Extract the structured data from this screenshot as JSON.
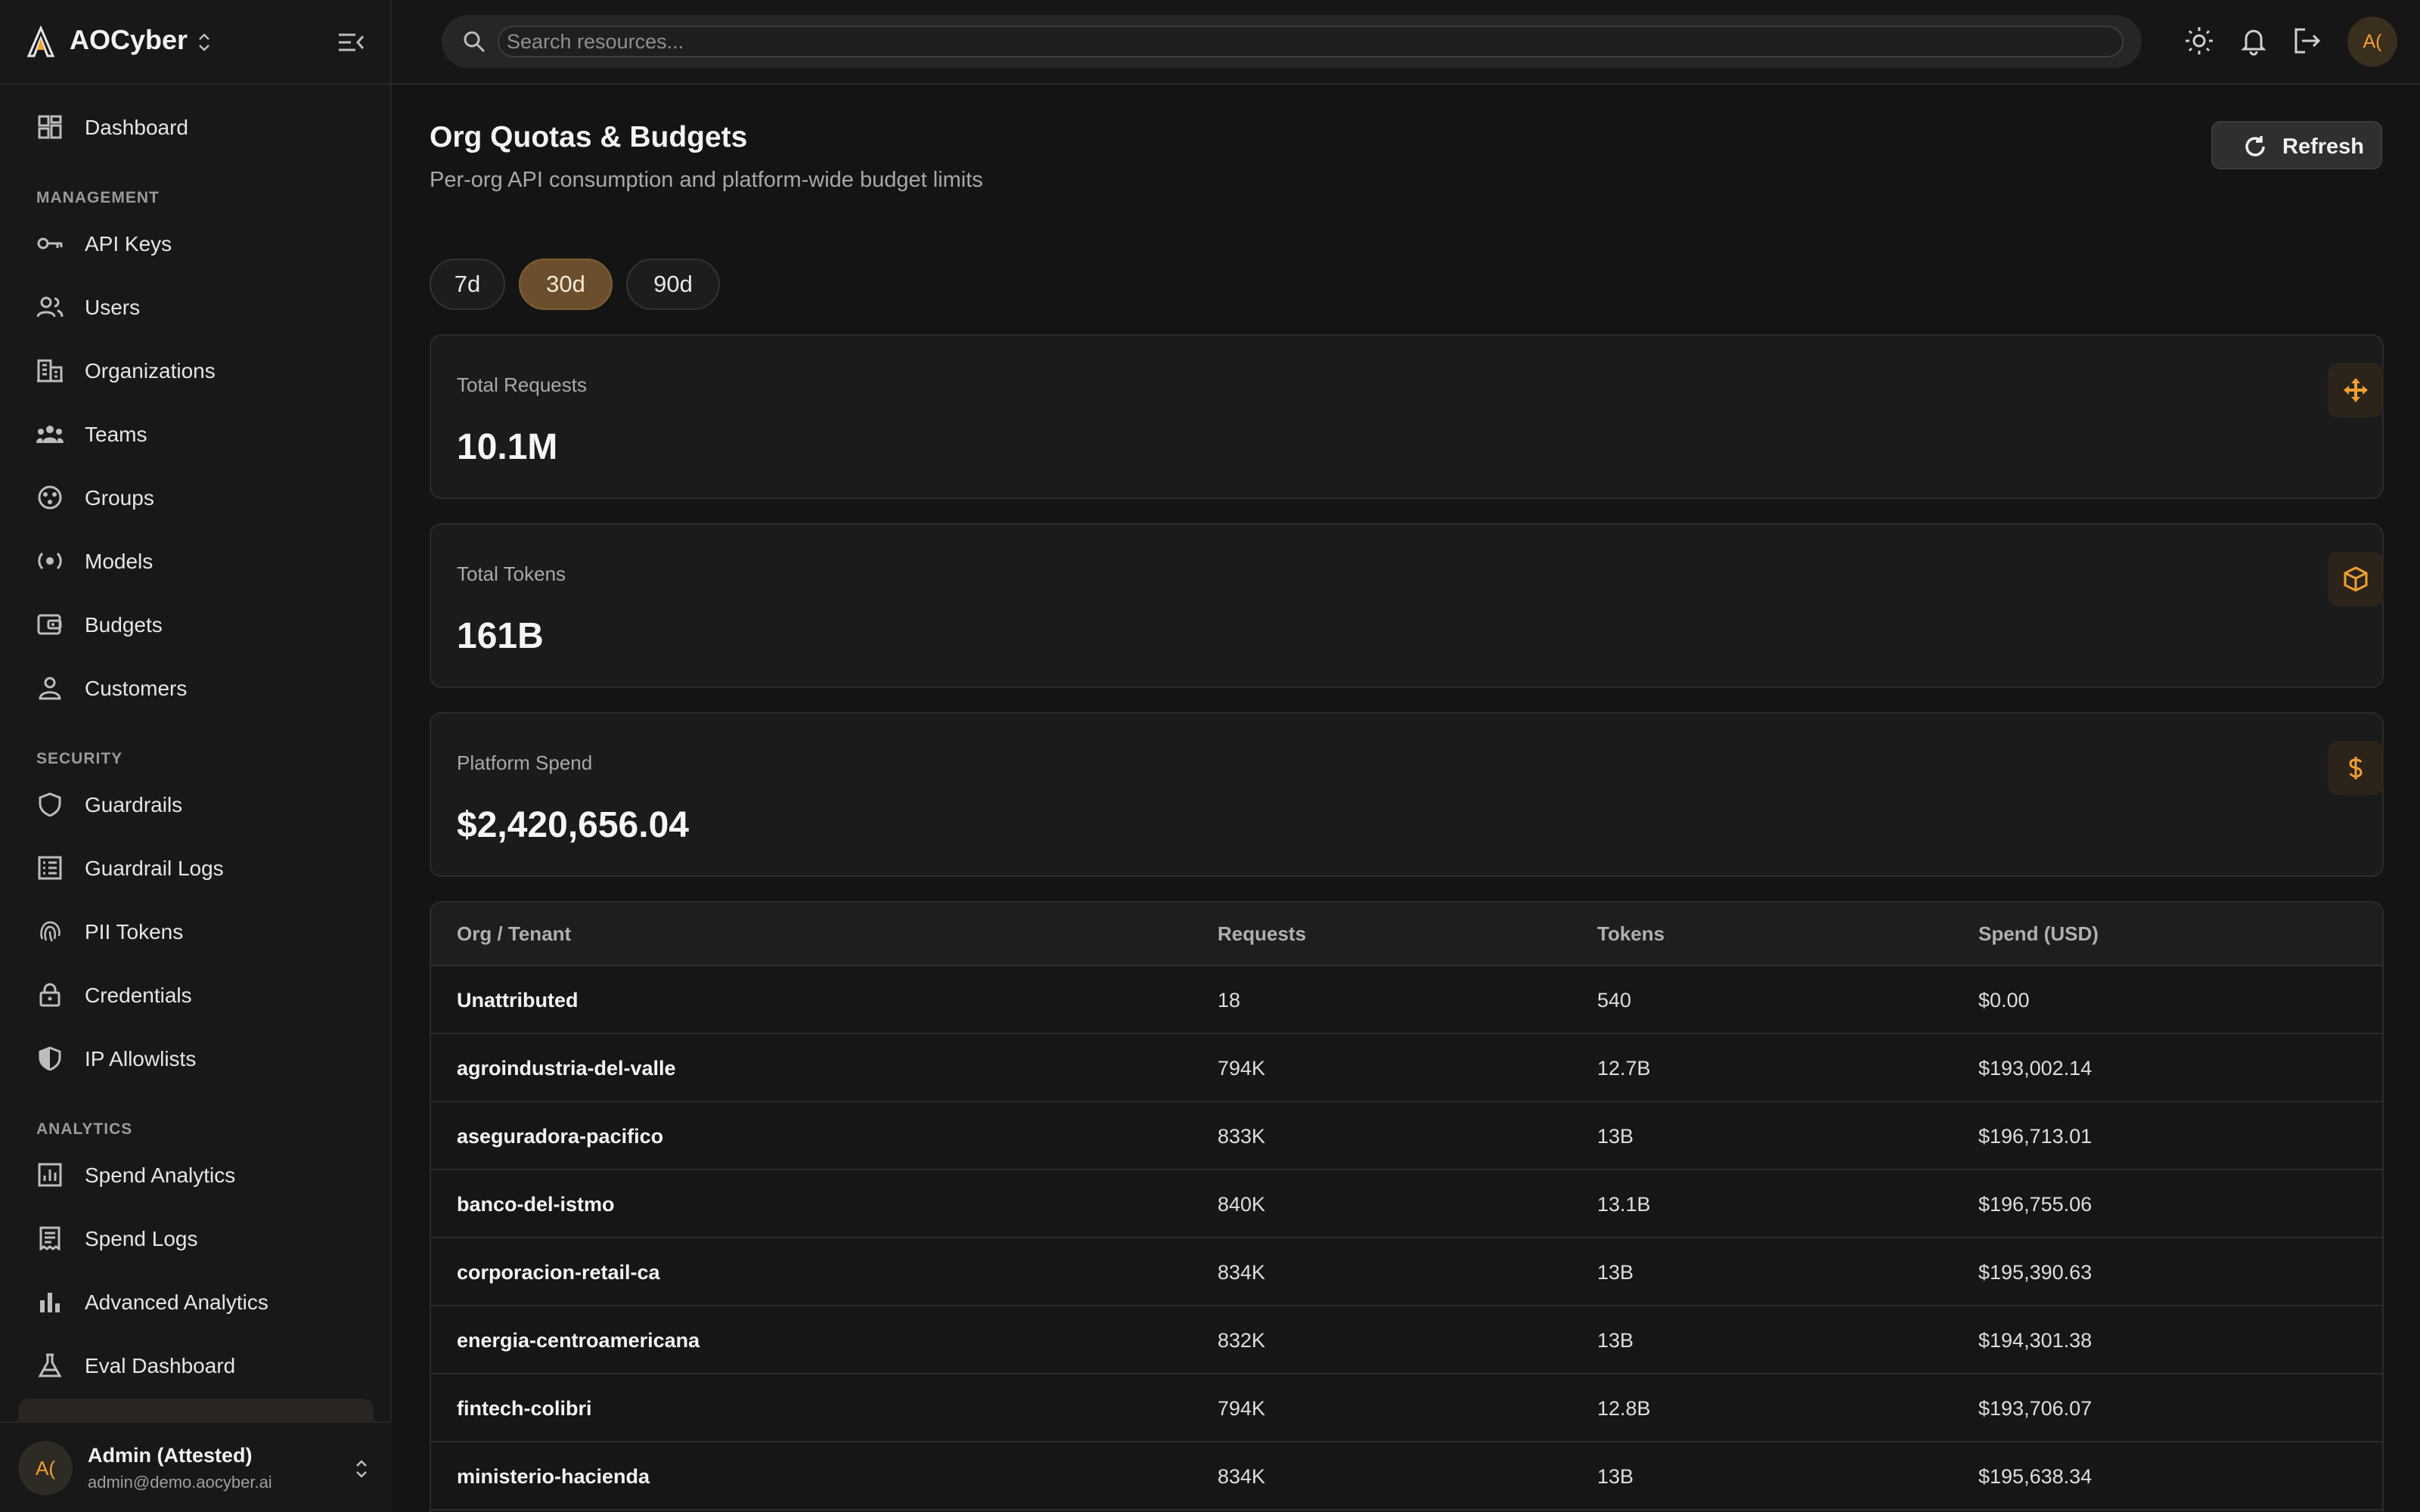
{
  "app": {
    "name": "AOCyber",
    "search_placeholder": "Search resources..."
  },
  "sidebar": {
    "top_items": [
      {
        "label": "Dashboard",
        "icon": "dashboard-icon"
      }
    ],
    "sections": [
      {
        "title": "MANAGEMENT",
        "items": [
          {
            "label": "API Keys",
            "icon": "key-icon"
          },
          {
            "label": "Users",
            "icon": "users-icon"
          },
          {
            "label": "Organizations",
            "icon": "building-icon"
          },
          {
            "label": "Teams",
            "icon": "team-icon"
          },
          {
            "label": "Groups",
            "icon": "groups-icon"
          },
          {
            "label": "Models",
            "icon": "model-icon"
          },
          {
            "label": "Budgets",
            "icon": "wallet-icon"
          },
          {
            "label": "Customers",
            "icon": "person-icon"
          }
        ]
      },
      {
        "title": "SECURITY",
        "items": [
          {
            "label": "Guardrails",
            "icon": "shield-icon"
          },
          {
            "label": "Guardrail Logs",
            "icon": "log-list-icon"
          },
          {
            "label": "PII Tokens",
            "icon": "fingerprint-icon"
          },
          {
            "label": "Credentials",
            "icon": "lock-icon"
          },
          {
            "label": "IP Allowlists",
            "icon": "shield-half-icon"
          }
        ]
      },
      {
        "title": "ANALYTICS",
        "items": [
          {
            "label": "Spend Analytics",
            "icon": "chart-box-icon"
          },
          {
            "label": "Spend Logs",
            "icon": "receipt-icon"
          },
          {
            "label": "Advanced Analytics",
            "icon": "bar-chart-icon"
          },
          {
            "label": "Eval Dashboard",
            "icon": "flask-icon"
          }
        ]
      }
    ],
    "user": {
      "initials": "A(",
      "name": "Admin (Attested)",
      "email": "admin@demo.aocyber.ai"
    }
  },
  "topbar": {
    "icons": [
      "sun-icon",
      "bell-icon",
      "logout-icon"
    ],
    "avatar_initials": "A("
  },
  "page": {
    "title": "Org Quotas & Budgets",
    "subtitle": "Per-org API consumption and platform-wide budget limits",
    "refresh_label": "Refresh",
    "ranges": [
      "7d",
      "30d",
      "90d"
    ],
    "selected_range": "30d",
    "accent_color": "#f0a030",
    "stats": [
      {
        "label": "Total Requests",
        "value": "10.1M",
        "icon": "requests-icon"
      },
      {
        "label": "Total Tokens",
        "value": "161B",
        "icon": "cube-icon"
      },
      {
        "label": "Platform Spend",
        "value": "$2,420,656.04",
        "icon": "dollar-icon"
      }
    ],
    "table": {
      "columns": [
        "Org / Tenant",
        "Requests",
        "Tokens",
        "Spend (USD)"
      ],
      "rows": [
        [
          "Unattributed",
          "18",
          "540",
          "$0.00"
        ],
        [
          "agroindustria-del-valle",
          "794K",
          "12.7B",
          "$193,002.14"
        ],
        [
          "aseguradora-pacifico",
          "833K",
          "13B",
          "$196,713.01"
        ],
        [
          "banco-del-istmo",
          "840K",
          "13.1B",
          "$196,755.06"
        ],
        [
          "corporacion-retail-ca",
          "834K",
          "13B",
          "$195,390.63"
        ],
        [
          "energia-centroamericana",
          "832K",
          "13B",
          "$194,301.38"
        ],
        [
          "fintech-colibri",
          "794K",
          "12.8B",
          "$193,706.07"
        ],
        [
          "ministerio-hacienda",
          "834K",
          "13B",
          "$195,638.34"
        ]
      ]
    }
  }
}
